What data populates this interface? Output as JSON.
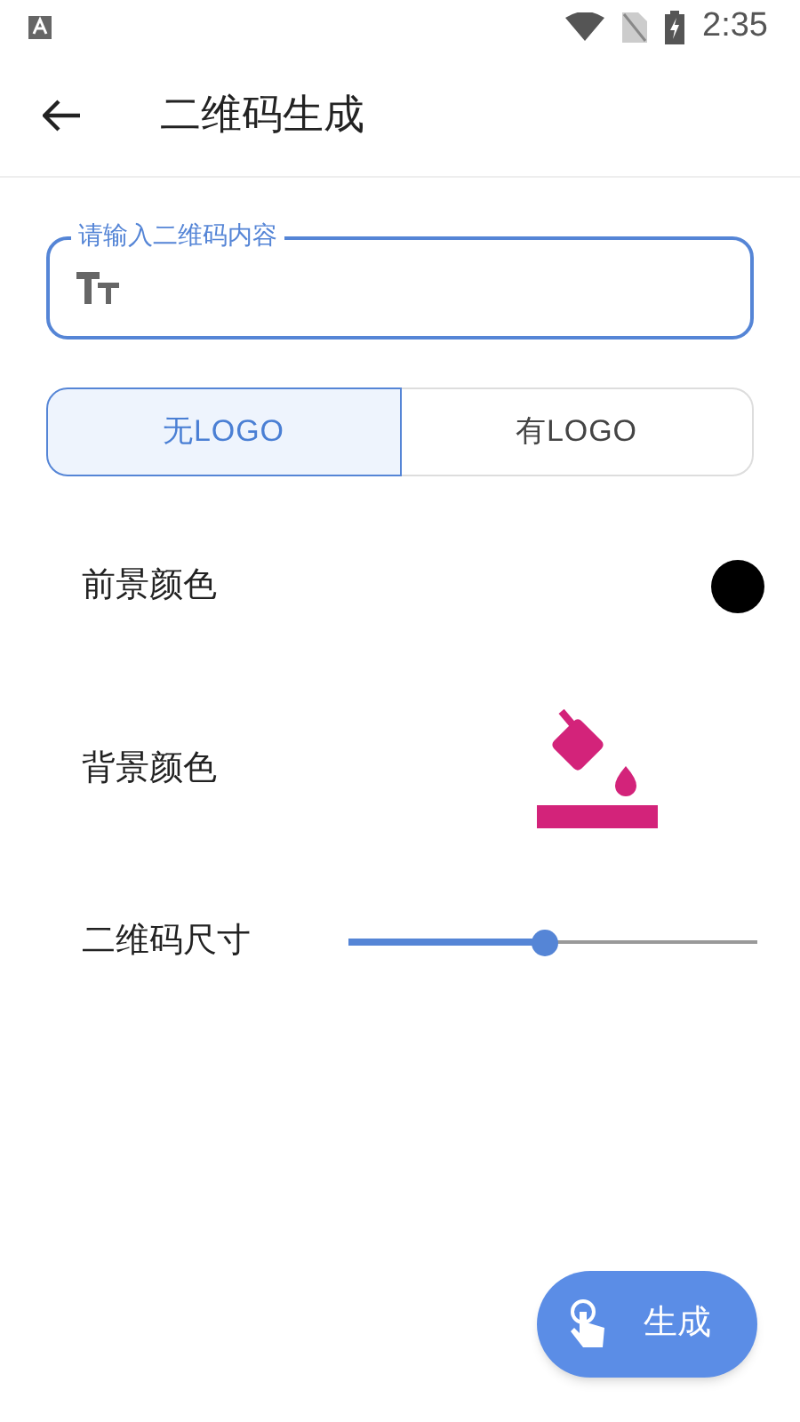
{
  "status_bar": {
    "time": "2:35"
  },
  "app_bar": {
    "title": "二维码生成"
  },
  "input": {
    "label": "请输入二维码内容"
  },
  "logo_options": [
    {
      "label": "无LOGO",
      "selected": true
    },
    {
      "label": "有LOGO",
      "selected": false
    }
  ],
  "settings": [
    {
      "kind": "dot",
      "label": "前景颜色",
      "color": "#000000"
    },
    {
      "kind": "bucket",
      "label": "背景颜色",
      "color": "#d3237a"
    },
    {
      "kind": "slider",
      "label": "二维码尺寸",
      "level": 0.48
    }
  ],
  "fab": {
    "label": "生成"
  }
}
